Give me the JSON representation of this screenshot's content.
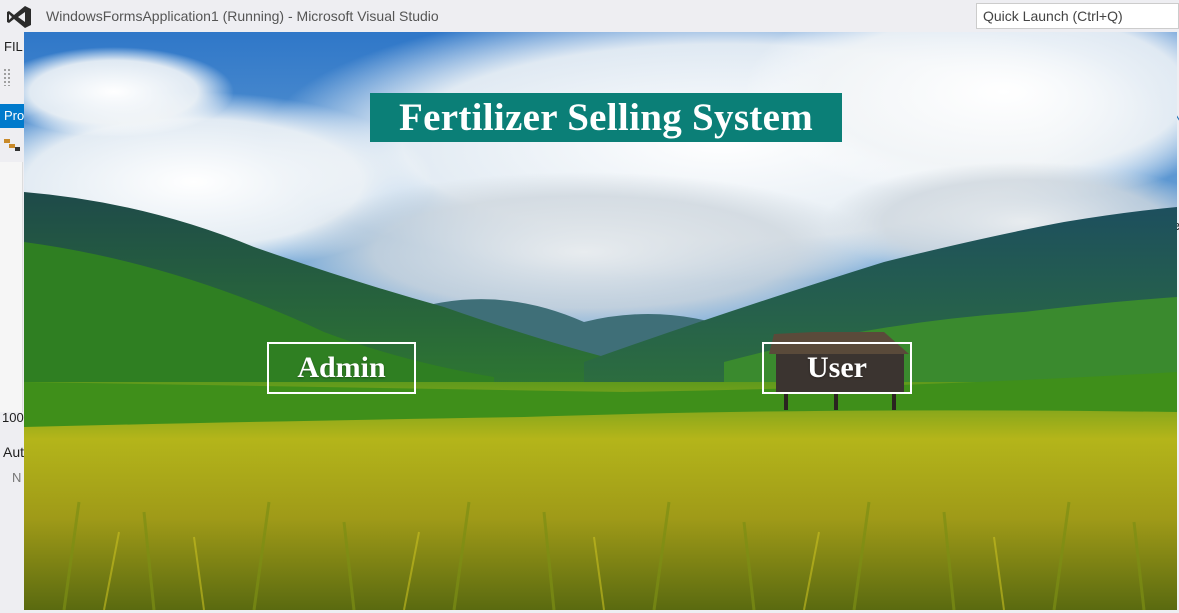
{
  "vs": {
    "window_title": "WindowsFormsApplication1 (Running) - Microsoft Visual Studio",
    "quick_launch_placeholder": "Quick Launch (Ctrl+Q)",
    "menu_fragment": "FIL",
    "tab_fragment": "Pro",
    "zoom_fragment": "100",
    "panel_fragment": "Aut",
    "column_fragment": "N"
  },
  "app": {
    "title": "Fertilizer Selling System",
    "admin_label": "Admin",
    "user_label": "User",
    "title_bg": "#0b7f77"
  }
}
